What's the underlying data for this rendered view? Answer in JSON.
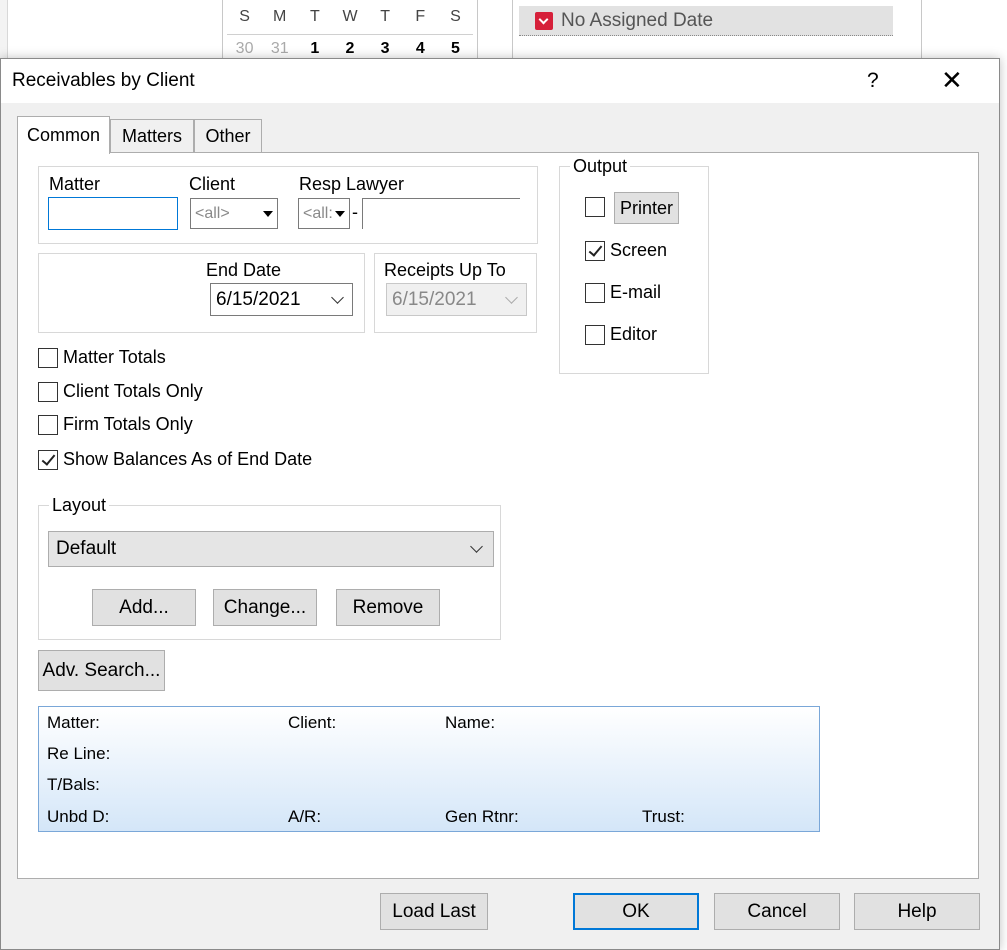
{
  "background": {
    "calendar_days": [
      "S",
      "M",
      "T",
      "W",
      "T",
      "F",
      "S"
    ],
    "calendar_dates": [
      "30",
      "31",
      "1",
      "2",
      "3",
      "4",
      "5"
    ],
    "agenda_item": "No Assigned Date"
  },
  "dialog": {
    "title": "Receivables by Client",
    "help_glyph": "?",
    "close_glyph": "✕"
  },
  "tabs": [
    {
      "label": "Common",
      "active": true
    },
    {
      "label": "Matters",
      "active": false
    },
    {
      "label": "Other",
      "active": false
    }
  ],
  "filters": {
    "matter_label": "Matter",
    "matter_value": "",
    "client_label": "Client",
    "client_value": "<all>",
    "resp_lawyer_label": "Resp Lawyer",
    "resp_lawyer_value": "<all:",
    "resp_lawyer_sep": "-",
    "resp_lawyer_name": ""
  },
  "dates": {
    "end_date_label": "End Date",
    "end_date_value": "6/15/2021",
    "receipts_label": "Receipts Up To",
    "receipts_value": "6/15/2021"
  },
  "options": [
    {
      "label": "Matter Totals",
      "checked": false
    },
    {
      "label": "Client Totals Only",
      "checked": false
    },
    {
      "label": "Firm Totals Only",
      "checked": false
    },
    {
      "label": "Show Balances As of End Date",
      "checked": true
    }
  ],
  "output": {
    "title": "Output",
    "printer_label": "Printer",
    "printer_checked": false,
    "screen_label": "Screen",
    "screen_checked": true,
    "email_label": "E-mail",
    "email_checked": false,
    "editor_label": "Editor",
    "editor_checked": false
  },
  "layout": {
    "title": "Layout",
    "selected": "Default",
    "add_label": "Add...",
    "change_label": "Change...",
    "remove_label": "Remove"
  },
  "adv_search_label": "Adv. Search...",
  "info_panel": {
    "matter": "Matter:",
    "client": "Client:",
    "name": "Name:",
    "re_line": "Re Line:",
    "t_bals": "T/Bals:",
    "unbd": "Unbd D:",
    "ar": "A/R:",
    "gen_rtnr": "Gen Rtnr:",
    "trust": "Trust:"
  },
  "footer": {
    "load_last_label": "Load Last",
    "ok_label": "OK",
    "cancel_label": "Cancel",
    "help_label": "Help"
  }
}
